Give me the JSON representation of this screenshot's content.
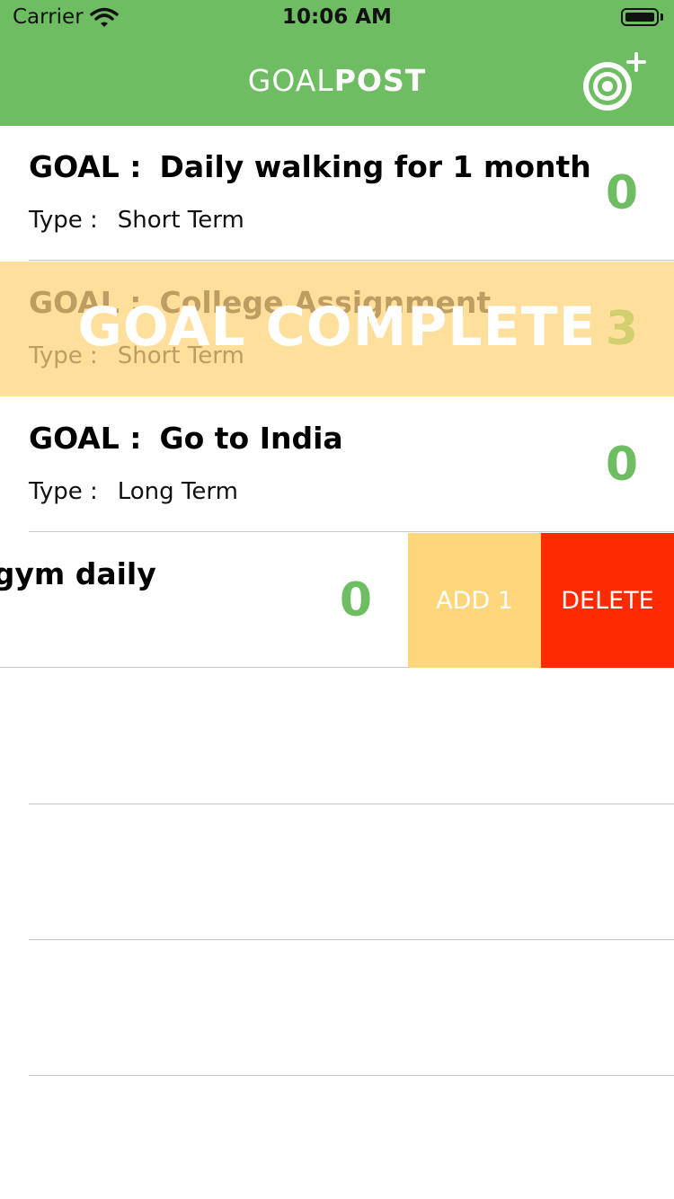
{
  "status_bar": {
    "carrier": "Carrier",
    "time": "10:06 AM"
  },
  "header": {
    "title_light": "GOAL",
    "title_bold": "POST",
    "add_icon": "target-plus-icon"
  },
  "labels": {
    "goal_prefix": "GOAL :",
    "type_prefix": "Type :"
  },
  "goals": [
    {
      "description": "Daily walking for 1 month",
      "type": "Short Term",
      "progress": "0"
    },
    {
      "description": "College Assignment",
      "type": "Short Term",
      "progress": "3",
      "complete_label": "GOAL COMPLETE"
    },
    {
      "description": "Go to India",
      "type": "Long Term",
      "progress": "0"
    },
    {
      "description": "Go to gym daily",
      "progress": "0"
    }
  ],
  "swipe_actions": {
    "add_label": "ADD 1",
    "delete_label": "DELETE"
  },
  "colors": {
    "brand_green": "#6fbd63",
    "complete_bg": "#fedf9b",
    "add_action": "#fed67c",
    "delete_action": "#fe2a00"
  }
}
